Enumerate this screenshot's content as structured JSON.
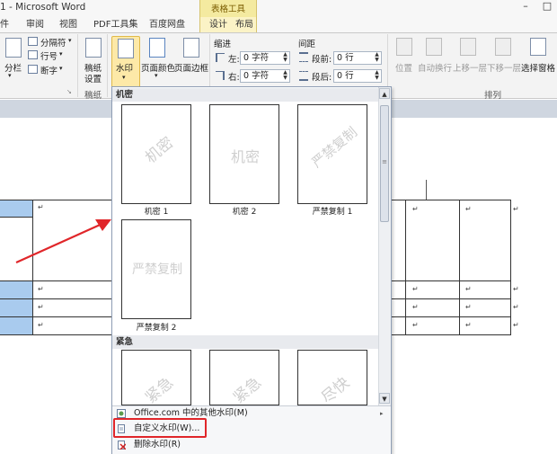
{
  "window": {
    "title": "1 - Microsoft Word",
    "minimize": "–",
    "maximize": "□"
  },
  "tabs": {
    "file_partial": "件",
    "review": "审阅",
    "view": "视图",
    "pdf_tools": "PDF工具集",
    "baidu": "百度网盘",
    "context_group": "表格工具",
    "design": "设计",
    "layout": "布局"
  },
  "ribbon": {
    "columns": "分栏",
    "breaks": "分隔符",
    "line_numbers": "行号",
    "hyphenation": "断字",
    "draft_paper_1": "稿纸",
    "draft_paper_2": "设置",
    "draft_group": "稿纸",
    "watermark": "水印",
    "page_color": "页面颜色",
    "page_borders": "页面边框",
    "indent_label": "缩进",
    "indent_left_label": "左:",
    "indent_left_value": "0 字符",
    "indent_right_label": "右:",
    "indent_right_value": "0 字符",
    "spacing_label": "间距",
    "spacing_before_label": "段前:",
    "spacing_before_value": "0 行",
    "spacing_after_label": "段后:",
    "spacing_after_value": "0 行",
    "position": "位置",
    "wrap_text": "自动换行",
    "bring_forward": "上移一层",
    "send_backward": "下移一层",
    "selection_pane": "选择窗格",
    "arrange_group": "排列"
  },
  "document": {
    "mark": "↵"
  },
  "gallery": {
    "category_1": "机密",
    "category_2": "紧急",
    "items": [
      {
        "label": "机密 1",
        "text": "机密"
      },
      {
        "label": "机密 2",
        "text": "机密"
      },
      {
        "label": "严禁复制 1",
        "text": "严禁复制"
      },
      {
        "label": "严禁复制 2",
        "text": "严禁复制"
      }
    ],
    "urgent_items": [
      {
        "text": "紧急"
      },
      {
        "text": "紧急"
      },
      {
        "text": "尽快"
      }
    ],
    "menu": {
      "more_online": "Office.com 中的其他水印(M)",
      "custom": "自定义水印(W)...",
      "remove": "删除水印(R)"
    }
  },
  "colors": {
    "annotation_red": "#e0262a",
    "cell_highlight": "#a9cbee",
    "watermark_button": "#fde9a8"
  }
}
